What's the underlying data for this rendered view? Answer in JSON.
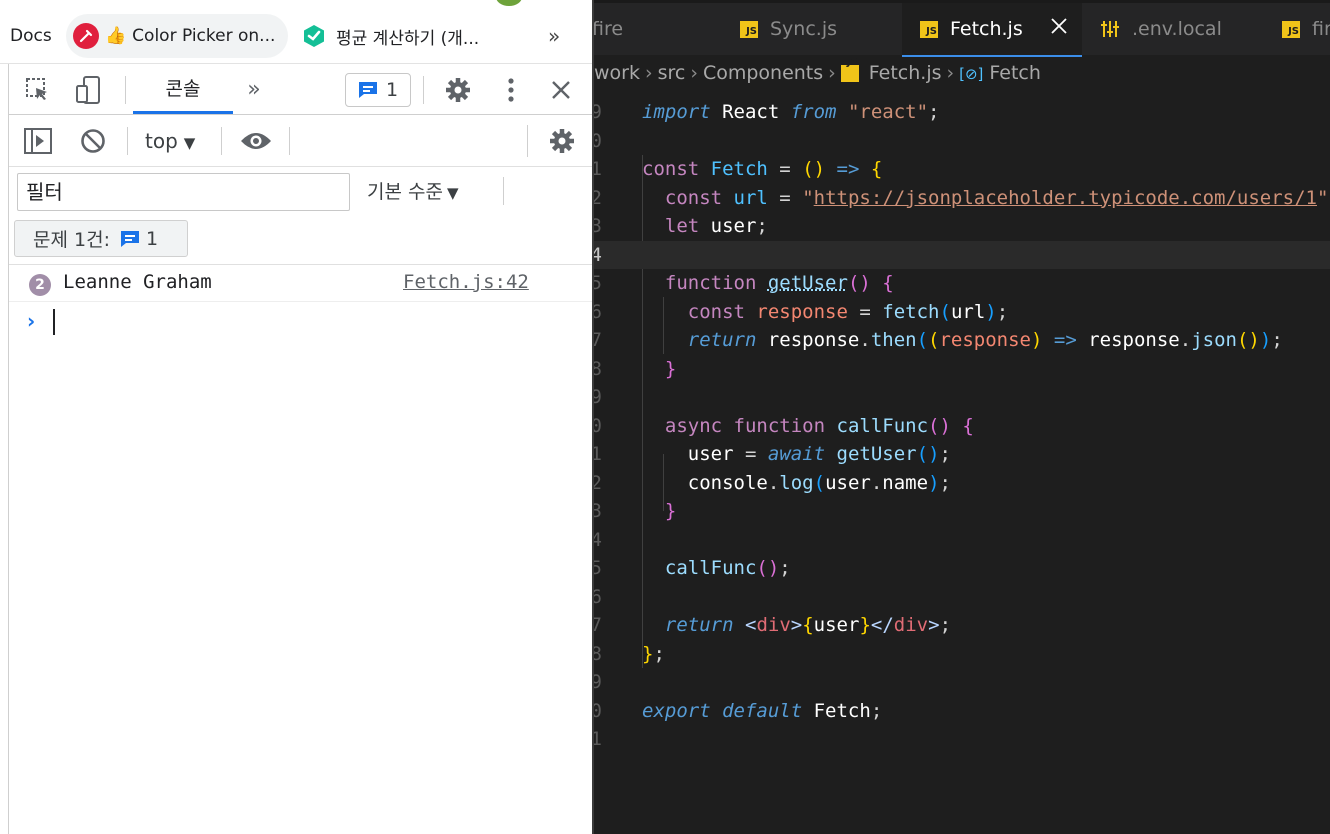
{
  "bookmarks": {
    "docs": "Docs",
    "color_picker": "Color Picker on...",
    "average_calc": "평균 계산하기 (개...",
    "more": "»"
  },
  "devtools": {
    "tab_console": "콘솔",
    "more_tabs": "»",
    "issue_count": "1",
    "context": "top",
    "filter_placeholder": "필터",
    "levels": "기본 수준",
    "issues_label": "문제 1건:",
    "issues_count": "1",
    "log": {
      "repeat_count": "2",
      "message": "Leanne Graham",
      "source": "Fetch.js:42"
    },
    "prompt": "›"
  },
  "editor": {
    "tabs": [
      {
        "label": "fire",
        "icon": "firebase-file-icon",
        "active": false
      },
      {
        "label": "Sync.js",
        "icon": "js-file-icon",
        "active": false
      },
      {
        "label": "Fetch.js",
        "icon": "js-file-icon",
        "active": true
      },
      {
        "label": ".env.local",
        "icon": "env-settings-icon",
        "active": false
      },
      {
        "label": "fire",
        "icon": "js-file-icon",
        "active": false
      }
    ],
    "breadcrumb": [
      "work",
      "src",
      "Components",
      "Fetch.js",
      "Fetch"
    ],
    "line_numbers": [
      "9",
      "0",
      "1",
      "2",
      "3",
      "4",
      "5",
      "6",
      "7",
      "8",
      "9",
      "0",
      "1",
      "2",
      "3",
      "4",
      "5",
      "6",
      "7",
      "8",
      "9",
      "0",
      "1"
    ],
    "code": {
      "l1": [
        "import",
        " React ",
        "from",
        " ",
        "\"react\"",
        ";"
      ],
      "l3": [
        "const",
        " Fetch ",
        "=",
        " ",
        "()",
        " ",
        "=>",
        " ",
        "{"
      ],
      "l4": [
        "const",
        " url ",
        "=",
        " ",
        "\"",
        "https://jsonplaceholder.typicode.com/users/1",
        "\"",
        ";"
      ],
      "l5": [
        "let",
        " user",
        ";"
      ],
      "l7": [
        "function",
        " ",
        "getUser",
        "()",
        " ",
        "{"
      ],
      "l8": [
        "const",
        " ",
        "response",
        " ",
        "=",
        " ",
        "fetch",
        "(",
        "url",
        ")",
        ";"
      ],
      "l9": [
        "return",
        " response",
        ".",
        "then",
        "(",
        "(",
        "response",
        ")",
        " ",
        "=>",
        " response",
        ".",
        "json",
        "()",
        ")",
        ";"
      ],
      "l10": [
        "}"
      ],
      "l12": [
        "async",
        " ",
        "function",
        " ",
        "callFunc",
        "()",
        " ",
        "{"
      ],
      "l13": [
        "user",
        " ",
        "=",
        " ",
        "await",
        " ",
        "getUser",
        "()",
        ";"
      ],
      "l14": [
        "console",
        ".",
        "log",
        "(",
        "user",
        ".",
        "name",
        ")",
        ";"
      ],
      "l15": [
        "}"
      ],
      "l17": [
        "callFunc",
        "()",
        ";"
      ],
      "l19": [
        "return",
        " ",
        "<",
        "div",
        ">",
        "{",
        "user",
        "}",
        "</",
        "div",
        ">",
        ";"
      ],
      "l20": [
        "}",
        ";"
      ],
      "l22": [
        "export",
        " ",
        "default",
        " Fetch",
        ";"
      ]
    }
  },
  "colors": {
    "devtools_accent": "#1a73e8",
    "editor_bg": "#1e1e1e",
    "tabbar_bg": "#252526",
    "js_badge": "#f0c419"
  }
}
